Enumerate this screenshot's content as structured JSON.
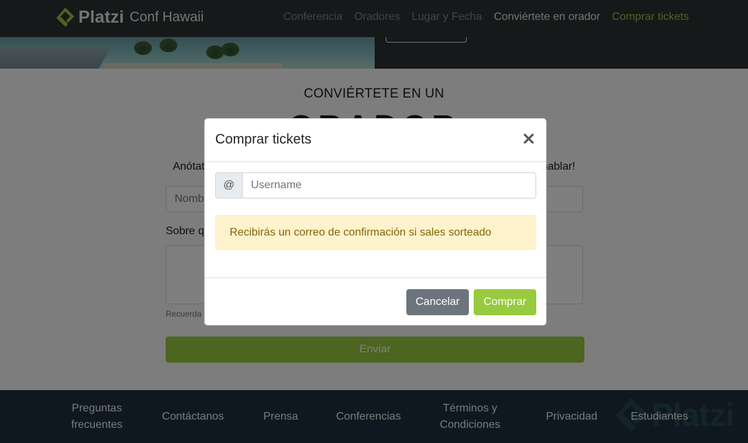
{
  "navbar": {
    "brand_platzi": "Platzi",
    "brand_conf": "Conf Hawaii",
    "links": [
      {
        "label": "Conferencia"
      },
      {
        "label": "Oradores"
      },
      {
        "label": "Lugar y Fecha"
      },
      {
        "label": "Conviértete en orador"
      },
      {
        "label": "Comprar tickets"
      }
    ]
  },
  "speaker_section": {
    "heading": "CONVIÉRTETE EN UN",
    "heading_big": "ORADOR",
    "intro": "Anótate como orador para dar una charla ignite. Cuéntanos de qué quieres hablar!",
    "name_placeholder": "Nombre",
    "topic_label": "Sobre qué quieres hablar?",
    "help_text": "Recuerda incluir un título para tu charla.",
    "send_label": "Enviar"
  },
  "modal": {
    "title": "Comprar tickets",
    "close_symbol": "×",
    "prepend_symbol": "@",
    "username_placeholder": "Username",
    "alert_text": "Recibirás un correo de confirmación si sales sorteado",
    "cancel_label": "Cancelar",
    "buy_label": "Comprar"
  },
  "footer": {
    "links": [
      {
        "label": "Preguntas frecuentes"
      },
      {
        "label": "Contáctanos"
      },
      {
        "label": "Prensa"
      },
      {
        "label": "Conferencias"
      },
      {
        "label": "Términos y Condiciones"
      },
      {
        "label": "Privacidad"
      },
      {
        "label": "Estudiantes"
      }
    ],
    "watermark": "Platzi"
  },
  "colors": {
    "accent": "#98ca3f",
    "navbar_bg": "#2d3133",
    "footer_bg": "#1f3042",
    "alert_bg": "#fff3cd",
    "alert_text": "#856404"
  },
  "icons": [
    "platzi-logo-icon",
    "close-icon"
  ]
}
